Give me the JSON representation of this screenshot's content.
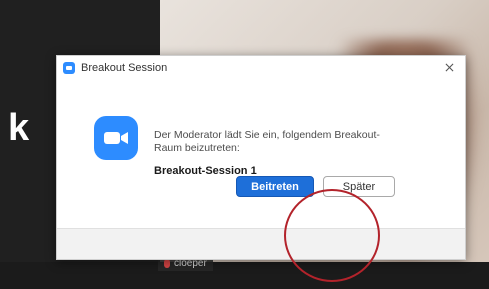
{
  "background": {
    "big_letter": "k",
    "participant_name": "cloeper"
  },
  "dialog": {
    "title": "Breakout Session",
    "app_icon": "zoom-app-icon",
    "close_icon": "close-icon",
    "message_line1": "Der Moderator lädt Sie ein, folgendem Breakout-",
    "message_line2": "Raum beizutreten:",
    "session_name": "Breakout-Session 1",
    "join_label": "Beitreten",
    "later_label": "Später"
  },
  "colors": {
    "accent": "#2d8cff",
    "primary_button": "#1e6fd9",
    "annotation": "#b3232b"
  }
}
